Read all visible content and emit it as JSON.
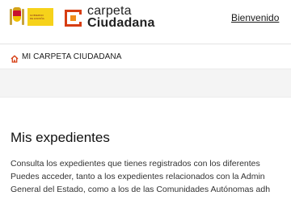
{
  "header": {
    "gov_logo_lines": [
      "GOBIERNO",
      "DE ESPAÑA"
    ],
    "brand_line1": "carpeta",
    "brand_line2": "Ciudadana",
    "welcome_link": "Bienvenido"
  },
  "breadcrumb": {
    "label": "MI CARPETA CIUDADANA",
    "icon": "home-icon"
  },
  "main": {
    "title": "Mis expedientes",
    "paragraph_lines": [
      "Consulta los expedientes que tienes registrados con los diferentes",
      "Puedes acceder, tanto a los expedientes relacionados con la Admin",
      "General del Estado, como a los de las Comunidades Autónomas adh"
    ]
  },
  "colors": {
    "brand_orange": "#d63d12",
    "brand_orange_light": "#f08c1a",
    "gov_yellow": "#f6d21a",
    "band_grey": "#f4f4f4"
  }
}
